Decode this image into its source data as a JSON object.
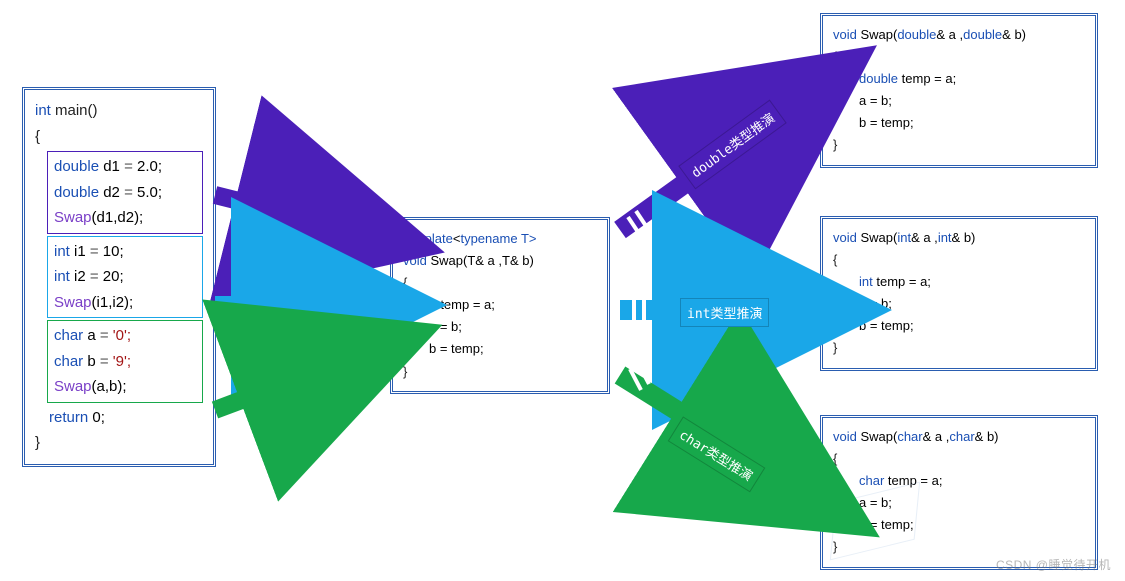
{
  "colors": {
    "purple": "#4b1fb8",
    "blue": "#1aa7e8",
    "green": "#17a84b",
    "box_border": "#2a5db0",
    "type": "#1a4fb4",
    "fn": "#7a3fc7"
  },
  "main_box": {
    "header_1": "int",
    "header_2": " main()",
    "brace_open": "{",
    "double_block": {
      "l1_a": "double",
      "l1_b": " d1 ",
      "l1_c": "=",
      "l1_d": " 2.0;",
      "l2_a": "double",
      "l2_b": " d2 ",
      "l2_c": "=",
      "l2_d": " 5.0;",
      "l3_a": "Swap",
      "l3_b": "(d1,d2);"
    },
    "int_block": {
      "l1_a": "int",
      "l1_b": " i1 ",
      "l1_c": "=",
      "l1_d": " 10;",
      "l2_a": "int",
      "l2_b": " i2 ",
      "l2_c": "=",
      "l2_d": " 20;",
      "l3_a": "Swap",
      "l3_b": "(i1,i2);"
    },
    "char_block": {
      "l1_a": "char",
      "l1_b": " a ",
      "l1_c": "=",
      "l1_d": " '0';",
      "l2_a": "char",
      "l2_b": " b ",
      "l2_c": "=",
      "l2_d": " '9';",
      "l3_a": "Swap",
      "l3_b": "(a,b);"
    },
    "ret_a": "return",
    "ret_b": " 0;",
    "brace_close": "}"
  },
  "template_box": {
    "l1_a": "template",
    "l1_b": "<",
    "l1_c": "typename",
    "l1_d": " T>",
    "l2_a": "void",
    "l2_b": " Swap(T& a ,T& b)",
    "brace_open": "{",
    "l3": "T temp = a;",
    "l4": "a = b;",
    "l5": "b = temp;",
    "brace_close": "}"
  },
  "double_box": {
    "l1_a": "void",
    "l1_b": " Swap(",
    "l1_c": "double",
    "l1_d": "& a ,",
    "l1_e": "double",
    "l1_f": "& b)",
    "brace_open": "{",
    "l2_a": "double",
    "l2_b": " temp = a;",
    "l3": "a = b;",
    "l4": "b = temp;",
    "brace_close": "}"
  },
  "int_box": {
    "l1_a": "void",
    "l1_b": " Swap(",
    "l1_c": "int",
    "l1_d": "& a ,",
    "l1_e": "int",
    "l1_f": "& b)",
    "brace_open": "{",
    "l2_a": "int",
    "l2_b": " temp = a;",
    "l3": "a = b;",
    "l4": "b = temp;",
    "brace_close": "}"
  },
  "char_box": {
    "l1_a": "void",
    "l1_b": " Swap(",
    "l1_c": "char",
    "l1_d": "& a ,",
    "l1_e": "char",
    "l1_f": "& b)",
    "brace_open": "{",
    "l2_a": "char",
    "l2_b": " temp = a;",
    "l3": "a = b;",
    "l4": "b = temp;",
    "brace_close": "}"
  },
  "labels": {
    "double": "double类型推演",
    "int": "int类型推演",
    "char": "char类型推演"
  },
  "watermark": "CSDN @睡觉待开机"
}
